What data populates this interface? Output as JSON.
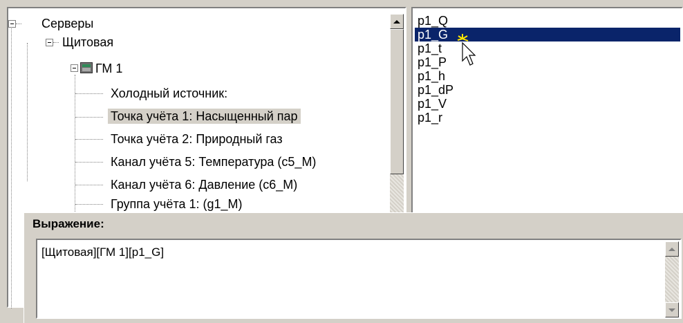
{
  "tree": {
    "items": [
      {
        "label": "Серверы"
      },
      {
        "label": "Щитовая"
      },
      {
        "label": "ГМ 1"
      },
      {
        "label": "Холодный источник:"
      },
      {
        "label": "Точка учёта 1: Насыщенный пар"
      },
      {
        "label": "Точка учёта 2: Природный газ"
      },
      {
        "label": "Канал учёта 5: Температура  (c5_M)"
      },
      {
        "label": "Канал учёта 6: Давление  (c6_M)"
      },
      {
        "label": "Группа учёта 1:   (g1_M)"
      }
    ]
  },
  "params": {
    "items": [
      "p1_Q",
      "p1_G",
      "p1_t",
      "p1_P",
      "p1_h",
      "p1_dP",
      "p1_V",
      "p1_r"
    ],
    "selected_index": 1
  },
  "expression": {
    "label": "Выражение:",
    "value": "[Щитовая][ГМ 1][p1_G]"
  },
  "icons": {
    "tree_collapse": "minus-box-icon",
    "device": "device-icon",
    "cursor": "arrow-cursor-icon",
    "scroll_up": "scroll-up-arrow-icon",
    "scroll_down": "scroll-down-arrow-icon"
  },
  "colors": {
    "selection": "#0a246a",
    "tree_selection": "#d4d0c8",
    "face": "#d4d0c8"
  }
}
